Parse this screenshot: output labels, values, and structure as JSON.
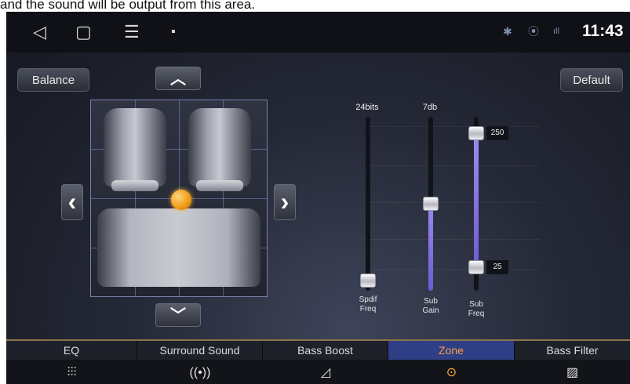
{
  "caption": "and the sound will be output from this area.",
  "statusbar": {
    "nav": [
      {
        "name": "back-icon",
        "glyph": "◁"
      },
      {
        "name": "home-icon",
        "glyph": "▢"
      },
      {
        "name": "menu-icon",
        "glyph": "☰"
      },
      {
        "name": "notification-icon",
        "glyph": "▪"
      }
    ],
    "bluetooth_glyph": "✱",
    "location_glyph": "⦿",
    "signal_glyph": "ıll",
    "time": "11:43"
  },
  "buttons": {
    "balance": "Balance",
    "default": "Default",
    "up_glyph": "︿",
    "down_glyph": "﹀",
    "left_glyph": "‹",
    "right_glyph": "›"
  },
  "sliders": [
    {
      "name": "spdif-freq",
      "top_label": "24bits",
      "label_line1": "Spdif",
      "label_line2": "Freq",
      "level": 0.0
    },
    {
      "name": "sub-gain",
      "top_label": "7db",
      "label_line1": "Sub",
      "label_line2": "Gain",
      "level": 0.5
    },
    {
      "name": "sub-freq",
      "label_line1": "Sub",
      "label_line2": "Freq",
      "range_high": "250",
      "range_low": "25"
    }
  ],
  "tabs": [
    {
      "label": "EQ",
      "icon": "equalizer-icon",
      "glyph": "⫶⫶⫶",
      "active": false
    },
    {
      "label": "Surround Sound",
      "icon": "surround-icon",
      "glyph": "((•))",
      "active": false
    },
    {
      "label": "Bass Boost",
      "icon": "bass-boost-icon",
      "glyph": "◿",
      "active": false
    },
    {
      "label": "Zone",
      "icon": "zone-icon",
      "glyph": "⊙",
      "active": true
    },
    {
      "label": "Bass Filter",
      "icon": "bass-filter-icon",
      "glyph": "▨",
      "active": false
    }
  ],
  "colors": {
    "accent_active_tab": "#2f3f86",
    "active_text": "#ff9a45",
    "position_dot": "#f09a12",
    "slider_fill": "#8a78e6"
  }
}
